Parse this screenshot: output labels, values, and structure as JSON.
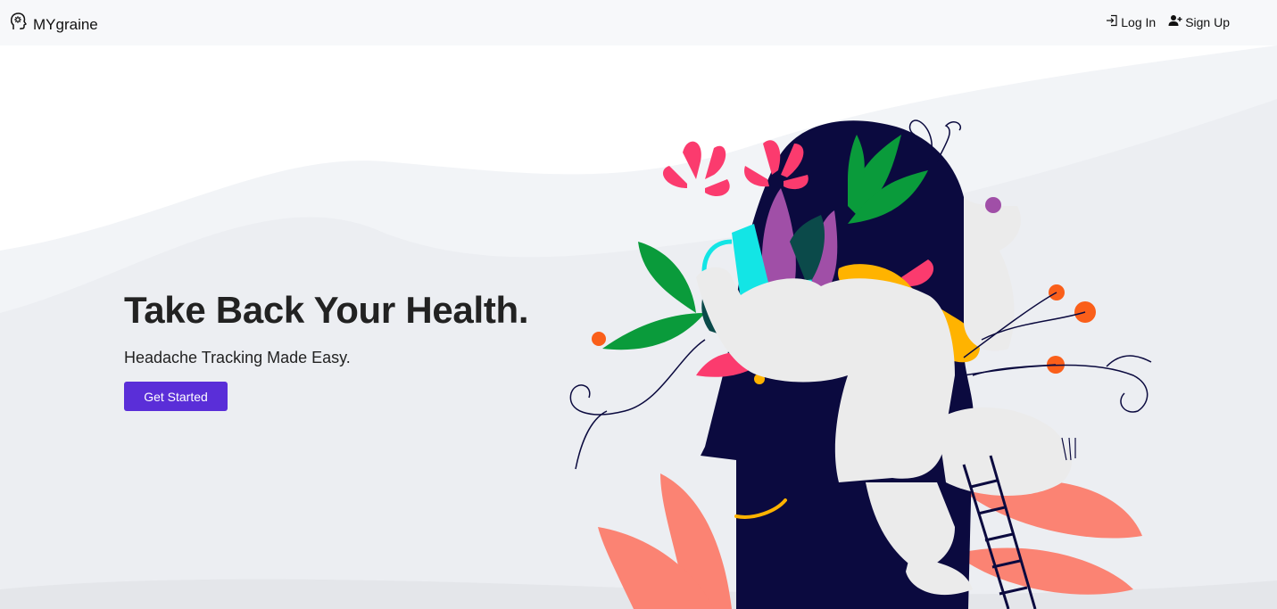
{
  "navbar": {
    "brand": "MYgraine",
    "brand_icon": "head-gear-icon",
    "links": [
      {
        "label": "Log In",
        "icon": "login-icon"
      },
      {
        "label": "Sign Up",
        "icon": "user-plus-icon"
      }
    ]
  },
  "hero": {
    "title": "Take Back Your Health.",
    "subtitle": "Headache Tracking Made Easy.",
    "cta_label": "Get Started",
    "illustration": "person-watering-plants-growing-from-head"
  },
  "colors": {
    "navbar_bg": "#f7f8fa",
    "hero_bg": "#eef0f3",
    "primary_button": "#5a2ed8",
    "head_navy": "#0b0a3f",
    "accent_pink": "#fb3b6e",
    "accent_orange": "#fa5f1a",
    "accent_yellow": "#ffb300",
    "accent_teal": "#13e5e5",
    "accent_green": "#0a9b3b",
    "accent_purple": "#a04fa7",
    "coral": "#fb8373"
  }
}
